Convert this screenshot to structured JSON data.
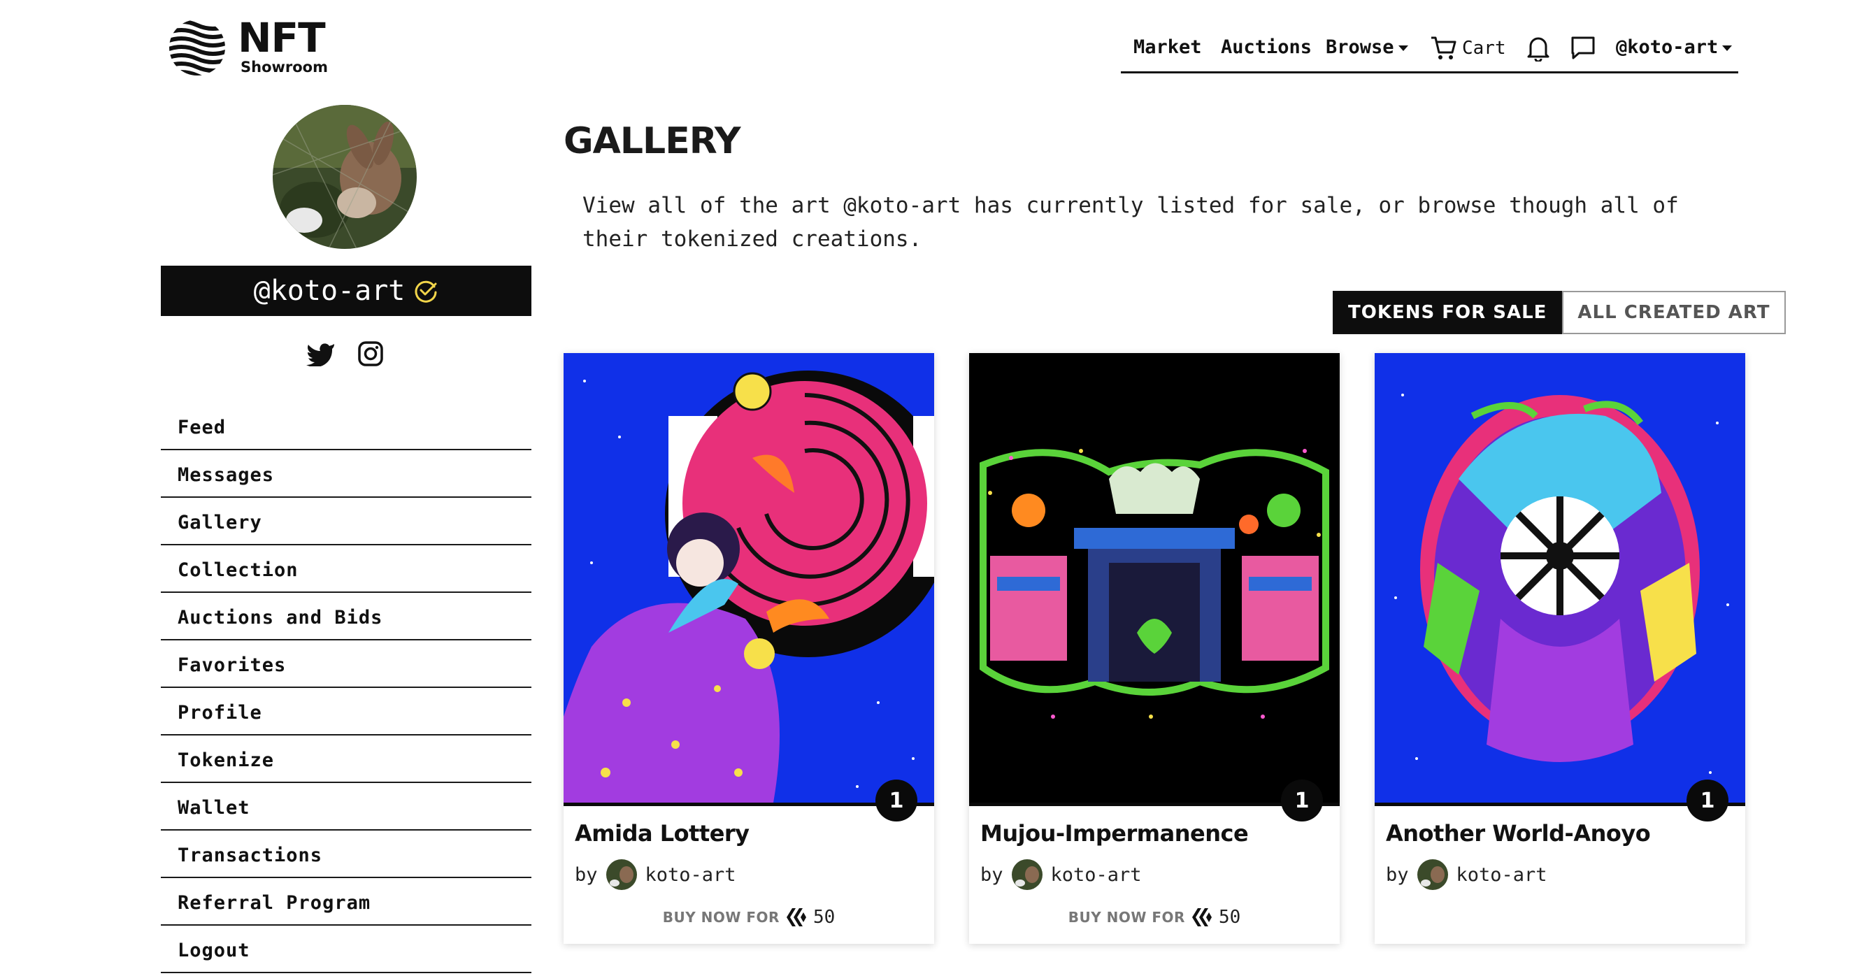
{
  "brand": {
    "title": "NFT",
    "subtitle": "Showroom"
  },
  "nav": {
    "market": "Market",
    "auctions": "Auctions",
    "browse": "Browse",
    "cart": "Cart",
    "user": "@koto-art"
  },
  "profile": {
    "username": "@koto-art",
    "verified": true,
    "socials": [
      "twitter-icon",
      "instagram-icon"
    ]
  },
  "sidebar": {
    "items": [
      {
        "label": "Feed"
      },
      {
        "label": "Messages"
      },
      {
        "label": "Gallery"
      },
      {
        "label": "Collection"
      },
      {
        "label": "Auctions and Bids"
      },
      {
        "label": "Favorites"
      },
      {
        "label": "Profile"
      },
      {
        "label": "Tokenize"
      },
      {
        "label": "Wallet"
      },
      {
        "label": "Transactions"
      },
      {
        "label": "Referral Program"
      },
      {
        "label": "Logout"
      }
    ]
  },
  "main": {
    "title": "GALLERY",
    "intro": "View all of the art @koto-art has currently listed for sale, or browse though all of their tokenized creations.",
    "tabs": [
      {
        "label": "TOKENS FOR SALE",
        "active": true
      },
      {
        "label": "ALL CREATED ART",
        "active": false
      }
    ]
  },
  "cards": [
    {
      "title": "Amida Lottery",
      "by": "by",
      "artist": "koto-art",
      "edition": "1",
      "buy_label": "BUY NOW FOR",
      "price": "50"
    },
    {
      "title": "Mujou-Impermanence",
      "by": "by",
      "artist": "koto-art",
      "edition": "1",
      "buy_label": "BUY NOW FOR",
      "price": "50"
    },
    {
      "title": "Another World-Anoyo",
      "by": "by",
      "artist": "koto-art",
      "edition": "1"
    }
  ],
  "colors": {
    "accent": "#0d0d0d",
    "verified": "#f2d54a",
    "art_blue": "#1030e8",
    "art_pink": "#e8307a",
    "art_purple": "#a23ce0"
  }
}
